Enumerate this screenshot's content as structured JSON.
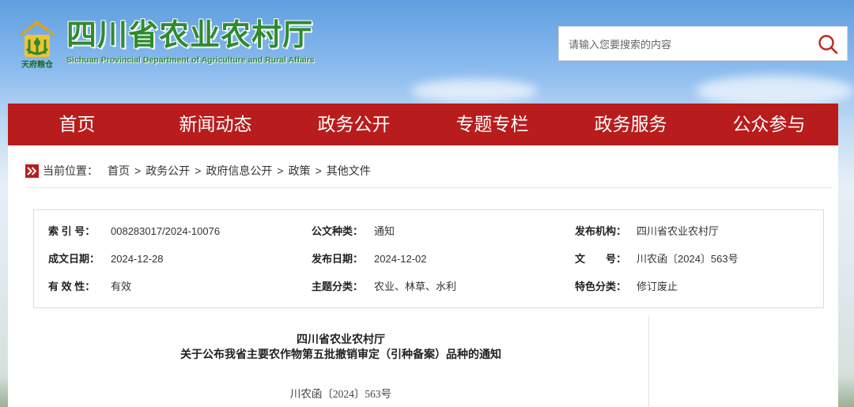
{
  "site": {
    "title": "四川省农业农村厅",
    "subtitle": "Sichuan Provincial Department of Agriculture and Rural Affairs",
    "emblem_text": "天府粮仓",
    "brand_green": "#2f8a2f",
    "brand_red": "#b91c1c"
  },
  "search": {
    "placeholder": "请输入您要搜索的内容",
    "icon": "search-icon"
  },
  "nav": {
    "items": [
      "首页",
      "新闻动态",
      "政务公开",
      "专题专栏",
      "政务服务",
      "公众参与"
    ]
  },
  "breadcrumb": {
    "label": "当前位置：",
    "items": [
      "首页",
      "政务公开",
      "政府信息公开",
      "政策",
      "其他文件"
    ],
    "separator": ">",
    "icon": "double-chevron-right-icon"
  },
  "info": {
    "index_no_label": "索 引 号：",
    "index_no": "008283017/2024-10076",
    "doc_type_label": "公文种类：",
    "doc_type": "通知",
    "issuer_label": "发布机构：",
    "issuer": "四川省农业农村厅",
    "created_label": "成文日期：",
    "created": "2024-12-28",
    "published_label": "发布日期：",
    "published": "2024-12-02",
    "doc_no_label": "文　　号：",
    "doc_no": "川农函〔2024〕563号",
    "validity_label": "有 效 性：",
    "validity": "有效",
    "topic_label": "主题分类：",
    "topic": "农业、林草、水利",
    "feature_label": "特色分类：",
    "feature": "修订废止"
  },
  "document": {
    "title_line1": "四川省农业农村厅",
    "title_line2": "关于公布我省主要农作物第五批撤销审定（引种备案）品种的通知",
    "number": "川农函〔2024〕563号"
  }
}
